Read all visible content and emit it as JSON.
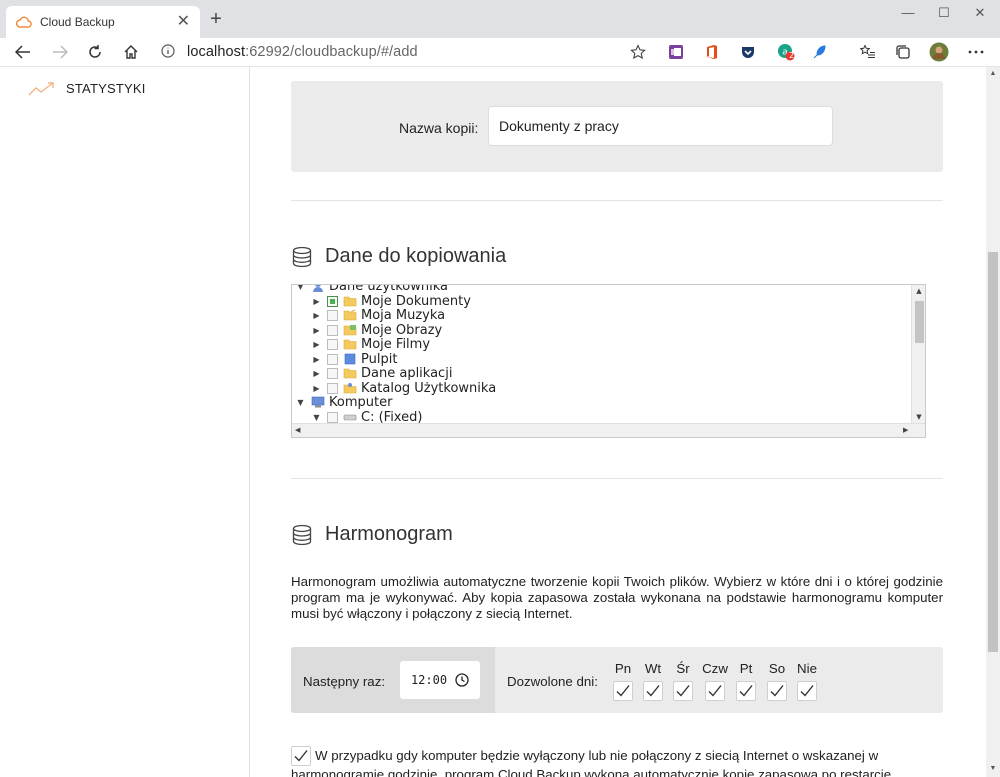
{
  "browser": {
    "tab_title": "Cloud Backup",
    "url_host": "localhost",
    "url_rest": ":62992/cloudbackup/#/add",
    "tab_close": "✕",
    "new_tab": "+",
    "minimize": "—",
    "maximize": "☐",
    "close": "✕",
    "extension_badge": "2"
  },
  "sidebar": {
    "items": [
      {
        "label": "STATYSTYKI",
        "icon": "trend-icon"
      }
    ]
  },
  "form": {
    "name_label": "Nazwa kopii:",
    "name_value": "Dokumenty z pracy"
  },
  "data_section": {
    "title": "Dane do kopiowania",
    "tree": [
      {
        "label": "Dane użytkownika",
        "level": 0,
        "expanded": true,
        "checkbox": false,
        "icon": "user-folder-icon"
      },
      {
        "label": "Moje Dokumenty",
        "level": 1,
        "expanded": false,
        "checkbox": true,
        "checked": true,
        "icon": "folder-icon"
      },
      {
        "label": "Moja Muzyka",
        "level": 1,
        "expanded": false,
        "checkbox": true,
        "checked": false,
        "icon": "music-folder-icon"
      },
      {
        "label": "Moje Obrazy",
        "level": 1,
        "expanded": false,
        "checkbox": true,
        "checked": false,
        "icon": "pictures-folder-icon"
      },
      {
        "label": "Moje Filmy",
        "level": 1,
        "expanded": false,
        "checkbox": true,
        "checked": false,
        "icon": "folder-icon"
      },
      {
        "label": "Pulpit",
        "level": 1,
        "expanded": false,
        "checkbox": true,
        "checked": false,
        "icon": "desktop-icon"
      },
      {
        "label": "Dane aplikacji",
        "level": 1,
        "expanded": false,
        "checkbox": true,
        "checked": false,
        "icon": "folder-icon"
      },
      {
        "label": "Katalog Użytkownika",
        "level": 1,
        "expanded": false,
        "checkbox": true,
        "checked": false,
        "icon": "user-folder-icon"
      },
      {
        "label": "Komputer",
        "level": 0,
        "expanded": true,
        "checkbox": false,
        "icon": "computer-icon"
      },
      {
        "label": "C: (Fixed)",
        "level": 1,
        "expanded": true,
        "checkbox": true,
        "checked": false,
        "icon": "drive-icon"
      }
    ]
  },
  "schedule_section": {
    "title": "Harmonogram",
    "description": "Harmonogram umożliwia automatyczne tworzenie kopii Twoich plików. Wybierz w które dni i o której godzinie program ma je wykonywać. Aby kopia zapasowa została wykonana na podstawie harmonogramu komputer musi być włączony i połączony z siecią Internet.",
    "next_label": "Następny raz:",
    "time_value": "12:00",
    "allowed_label": "Dozwolone dni:",
    "days": [
      {
        "label": "Pn",
        "checked": true
      },
      {
        "label": "Wt",
        "checked": true
      },
      {
        "label": "Śr",
        "checked": true
      },
      {
        "label": "Czw",
        "checked": true
      },
      {
        "label": "Pt",
        "checked": true
      },
      {
        "label": "So",
        "checked": true
      },
      {
        "label": "Nie",
        "checked": true
      }
    ],
    "missed_text": "W przypadku gdy komputer będzie wyłączony lub nie połączony z siecią Internet o wskazanej w harmonogramie godzinie, program Cloud Backup wykona automatycznie kopię zapasową po restarcie",
    "missed_checked": true
  },
  "colors": {
    "accent": "#f08a3c",
    "panel": "#ebebeb"
  }
}
